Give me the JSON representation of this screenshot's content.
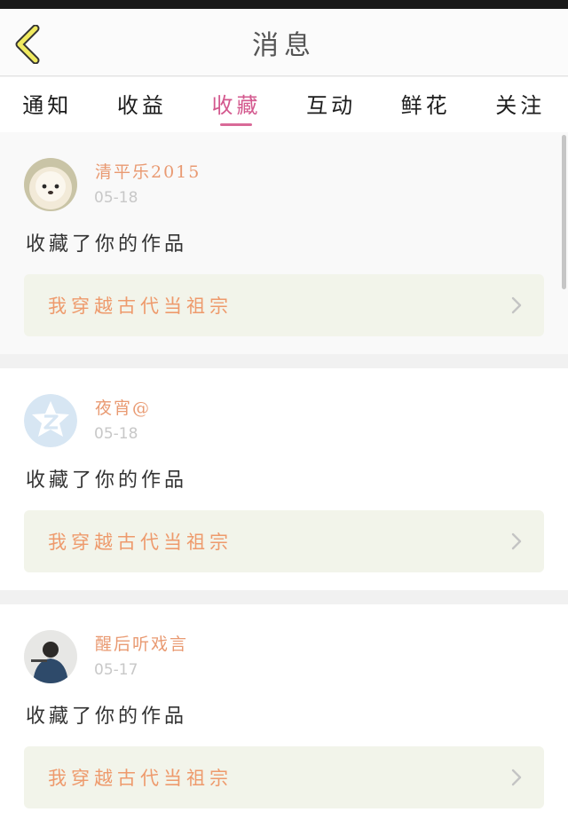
{
  "header": {
    "title": "消息",
    "back_icon": "chevron-left-icon"
  },
  "tabs": [
    {
      "label": "通知",
      "active": false
    },
    {
      "label": "收益",
      "active": false
    },
    {
      "label": "收藏",
      "active": true
    },
    {
      "label": "互动",
      "active": false
    },
    {
      "label": "鲜花",
      "active": false
    },
    {
      "label": "关注",
      "active": false
    }
  ],
  "messages": [
    {
      "user": "清平乐2015",
      "date": "05-18",
      "action": "收藏了你的作品",
      "work": "我穿越古代当祖宗",
      "avatar": "pomeranian-dog-photo"
    },
    {
      "user": "夜宵@",
      "date": "05-18",
      "action": "收藏了你的作品",
      "work": "我穿越古代当祖宗",
      "avatar": "default-z-avatar"
    },
    {
      "user": "醒后听戏言",
      "date": "05-17",
      "action": "收藏了你的作品",
      "work": "我穿越古代当祖宗",
      "avatar": "girl-back-photo"
    }
  ],
  "colors": {
    "accent": "#d3588e",
    "username": "#e99a72",
    "work_title": "#ee9a6c",
    "back_icon": "#f0ea60",
    "work_bg": "#f2f4ea"
  }
}
